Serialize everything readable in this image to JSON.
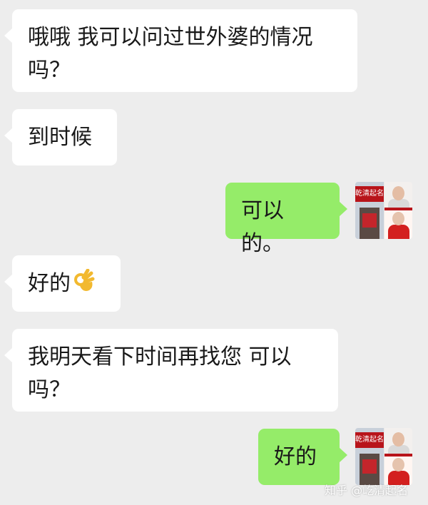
{
  "messages": [
    {
      "id": "m1",
      "side": "left",
      "text": "哦哦 我可以问过世外婆的情况吗？"
    },
    {
      "id": "m2",
      "side": "left",
      "text": "到时候"
    },
    {
      "id": "m3",
      "side": "right",
      "text": "可以的。"
    },
    {
      "id": "m4",
      "side": "left",
      "text": "好的",
      "emoji": "👌"
    },
    {
      "id": "m5",
      "side": "left",
      "text": "我明天看下时间再找您 可以吗？"
    },
    {
      "id": "m6",
      "side": "right",
      "text": "好的"
    }
  ],
  "avatar": {
    "sign_text": "乾清起名"
  },
  "watermark": "知乎 @屹清起名",
  "colors": {
    "background": "#ededed",
    "incoming_bubble": "#ffffff",
    "outgoing_bubble": "#95ec69"
  }
}
